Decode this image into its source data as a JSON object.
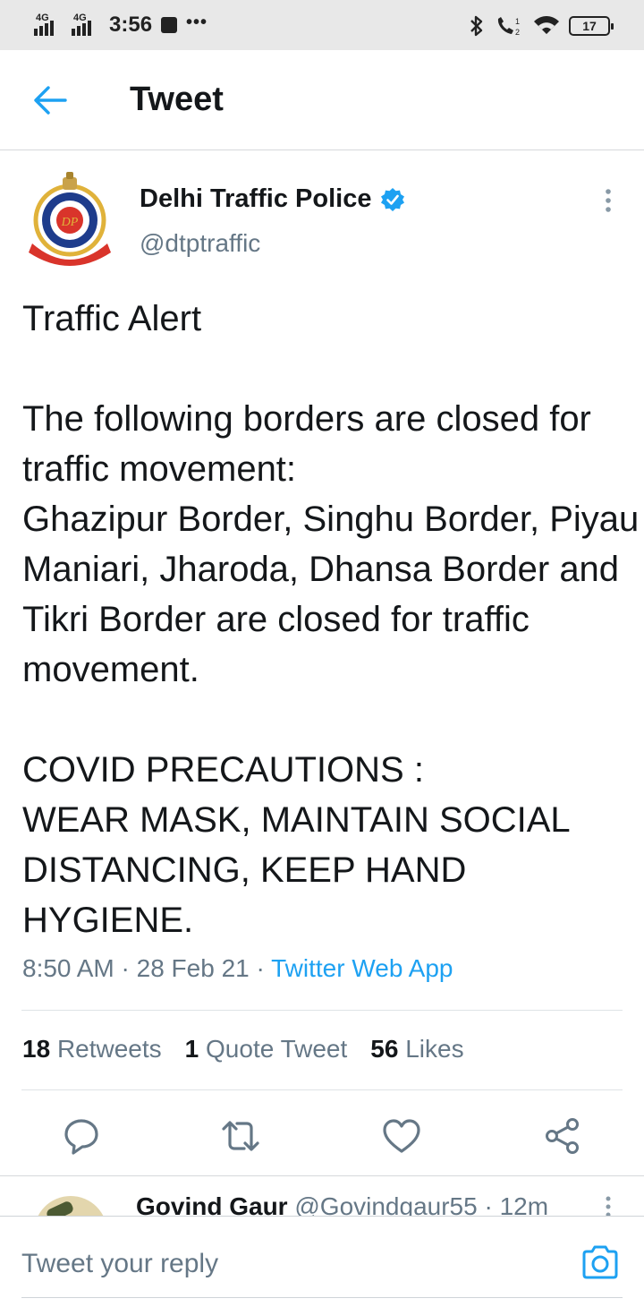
{
  "status_bar": {
    "network_1": "4G",
    "network_2": "4G",
    "time": "3:56",
    "overflow_dots": "•••",
    "battery": "17",
    "icons": [
      "signal-icon",
      "signal-icon",
      "notification-square-icon",
      "bluetooth-icon",
      "wifi-calling-icon",
      "wifi-icon",
      "battery-icon"
    ]
  },
  "header": {
    "title": "Tweet",
    "back_icon": "arrow-left-icon"
  },
  "tweet": {
    "author_name": "Delhi Traffic Police",
    "verified_icon": "verified-badge-icon",
    "handle": "@dtptraffic",
    "text": "Traffic Alert\n\nThe following borders are closed for traffic movement:\nGhazipur Border, Singhu Border, Piyau Maniari, Jharoda, Dhansa Border and Tikri Border are closed for traffic movement.\n\nCOVID PRECAUTIONS :\nWEAR MASK, MAINTAIN SOCIAL DISTANCING, KEEP HAND HYGIENE.",
    "time": "8:50 AM",
    "date": "28 Feb 21",
    "source": "Twitter Web App",
    "separator": "·"
  },
  "stats": {
    "retweets_count": "18",
    "retweets_label": "Retweets",
    "quotes_count": "1",
    "quotes_label": "Quote Tweet",
    "likes_count": "56",
    "likes_label": "Likes"
  },
  "actions": [
    "reply-icon",
    "retweet-icon",
    "like-icon",
    "share-icon"
  ],
  "reply_preview": {
    "name": "Govind Gaur",
    "handle": "@Govindgaur55",
    "age": "12m",
    "separator": "·"
  },
  "reply_bar": {
    "placeholder": "Tweet your reply",
    "camera_icon": "camera-icon"
  },
  "colors": {
    "accent": "#1da1f2",
    "secondary_text": "#657786",
    "primary_text": "#14171a",
    "status_bar_bg": "#e8e8e8"
  }
}
